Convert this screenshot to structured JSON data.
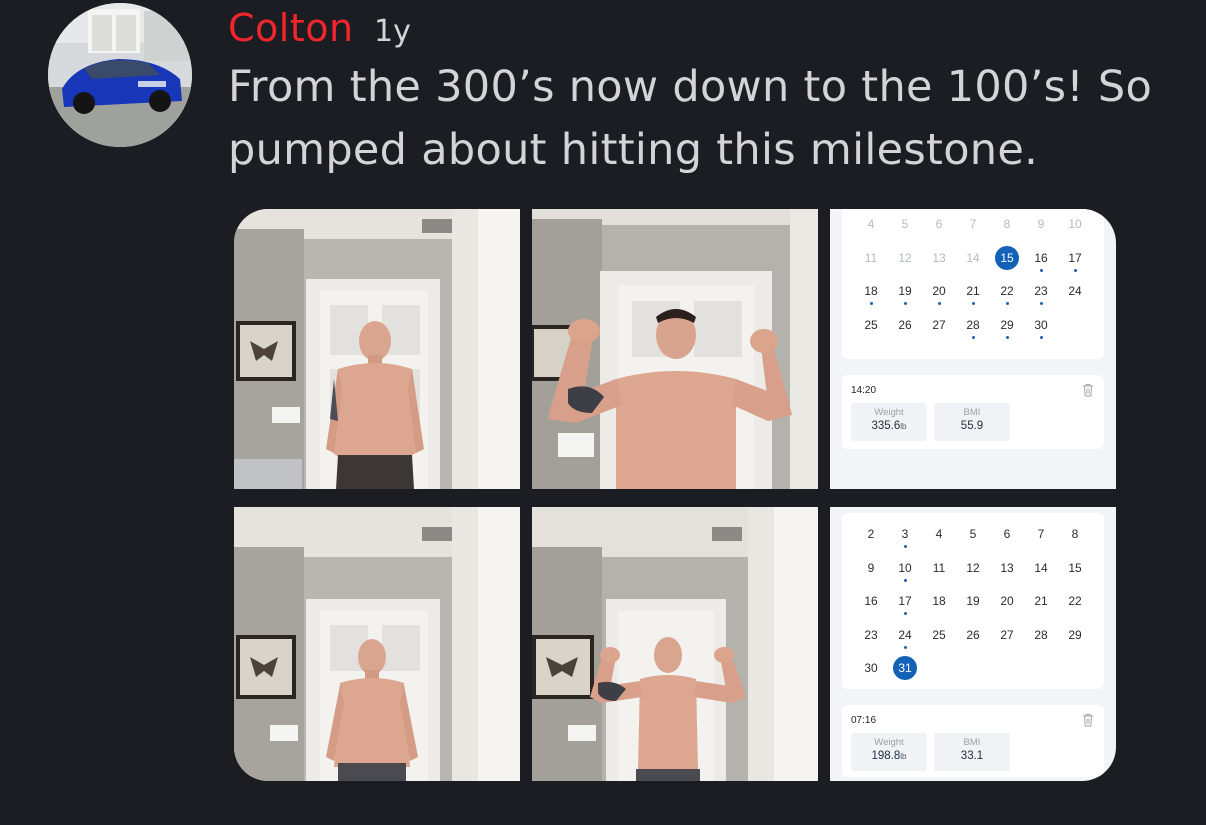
{
  "post": {
    "author": "Colton",
    "age": "1y",
    "text": "From the 300’s now down to the 100’s! So pumped about hitting this milestone."
  },
  "calendar_before": {
    "weeks": [
      [
        {
          "d": "4",
          "dim": true
        },
        {
          "d": "5",
          "dim": true
        },
        {
          "d": "6",
          "dim": true
        },
        {
          "d": "7",
          "dim": true
        },
        {
          "d": "8",
          "dim": true
        },
        {
          "d": "9",
          "dim": true
        },
        {
          "d": "10",
          "dim": true
        }
      ],
      [
        {
          "d": "11",
          "dim": true
        },
        {
          "d": "12",
          "dim": true
        },
        {
          "d": "13",
          "dim": true
        },
        {
          "d": "14",
          "dim": true
        },
        {
          "d": "15",
          "sel": true
        },
        {
          "d": "16",
          "dot": true
        },
        {
          "d": "17",
          "dot": true
        }
      ],
      [
        {
          "d": "18",
          "dot": true
        },
        {
          "d": "19",
          "dot": true
        },
        {
          "d": "20",
          "dot": true
        },
        {
          "d": "21",
          "dot": true
        },
        {
          "d": "22",
          "dot": true
        },
        {
          "d": "23",
          "dot": true
        },
        {
          "d": "24"
        }
      ],
      [
        {
          "d": "25"
        },
        {
          "d": "26"
        },
        {
          "d": "27"
        },
        {
          "d": "28",
          "dot": true
        },
        {
          "d": "29",
          "dot": true
        },
        {
          "d": "30",
          "dot": true
        },
        {
          "d": ""
        }
      ]
    ],
    "time": "14:20",
    "weight_label": "Weight",
    "weight_value": "335.6",
    "weight_unit": "lb",
    "bmi_label": "BMI",
    "bmi_value": "55.9"
  },
  "calendar_after": {
    "weeks": [
      [
        {
          "d": "2"
        },
        {
          "d": "3",
          "dot": true
        },
        {
          "d": "4"
        },
        {
          "d": "5"
        },
        {
          "d": "6"
        },
        {
          "d": "7"
        },
        {
          "d": "8"
        }
      ],
      [
        {
          "d": "9"
        },
        {
          "d": "10",
          "dot": true
        },
        {
          "d": "11"
        },
        {
          "d": "12"
        },
        {
          "d": "13"
        },
        {
          "d": "14"
        },
        {
          "d": "15"
        }
      ],
      [
        {
          "d": "16"
        },
        {
          "d": "17",
          "dot": true
        },
        {
          "d": "18"
        },
        {
          "d": "19"
        },
        {
          "d": "20"
        },
        {
          "d": "21"
        },
        {
          "d": "22"
        }
      ],
      [
        {
          "d": "23"
        },
        {
          "d": "24",
          "dot": true
        },
        {
          "d": "25"
        },
        {
          "d": "26"
        },
        {
          "d": "27"
        },
        {
          "d": "28"
        },
        {
          "d": "29"
        }
      ],
      [
        {
          "d": "30"
        },
        {
          "d": "31",
          "sel": true
        },
        {
          "d": ""
        },
        {
          "d": ""
        },
        {
          "d": ""
        },
        {
          "d": ""
        },
        {
          "d": ""
        }
      ]
    ],
    "time": "07:16",
    "weight_label": "Weight",
    "weight_value": "198.8",
    "weight_unit": "lb",
    "bmi_label": "BMI",
    "bmi_value": "33.1"
  },
  "colors": {
    "background": "#1c1d22",
    "author": "#f2252c",
    "text": "#d4d4d8",
    "selected_day": "#1462b8"
  }
}
